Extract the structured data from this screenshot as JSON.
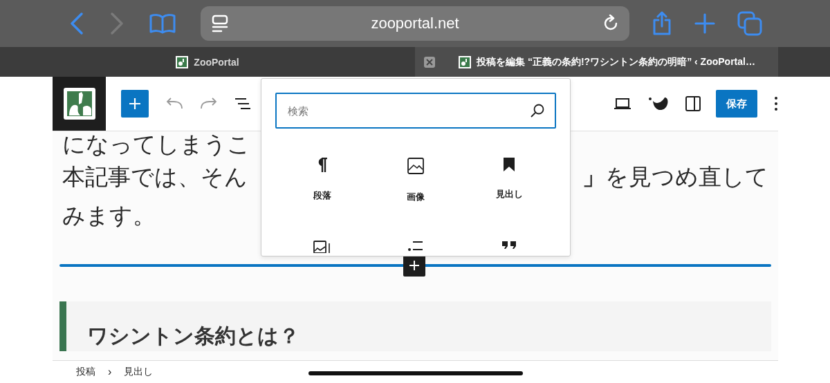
{
  "browser": {
    "url": "zooportal.net",
    "back_enabled": true,
    "forward_enabled": false
  },
  "tabs": [
    {
      "title": "ZooPortal",
      "selected": false
    },
    {
      "title": "投稿を編集 “正義の条約!?ワシントン条約の明暗” ‹ ZooPortal…",
      "selected": true
    }
  ],
  "toolbar": {
    "save_label": "保存"
  },
  "inserter": {
    "search_placeholder": "検索",
    "blocks": [
      {
        "label": "段落",
        "kind": "paragraph"
      },
      {
        "label": "画像",
        "kind": "image"
      },
      {
        "label": "見出し",
        "kind": "heading"
      },
      {
        "kind": "media-text"
      },
      {
        "kind": "list"
      },
      {
        "kind": "quote"
      }
    ]
  },
  "content": {
    "lines": [
      {
        "left": "になってしまうこ"
      },
      {
        "left": "本記事では、そん",
        "right": "**」**を見つめ直して"
      },
      {
        "left": "みます。"
      }
    ],
    "heading": "ワシントン条約とは？"
  },
  "breadcrumb": {
    "items": [
      "投稿",
      "見出し"
    ],
    "separator": "›"
  }
}
